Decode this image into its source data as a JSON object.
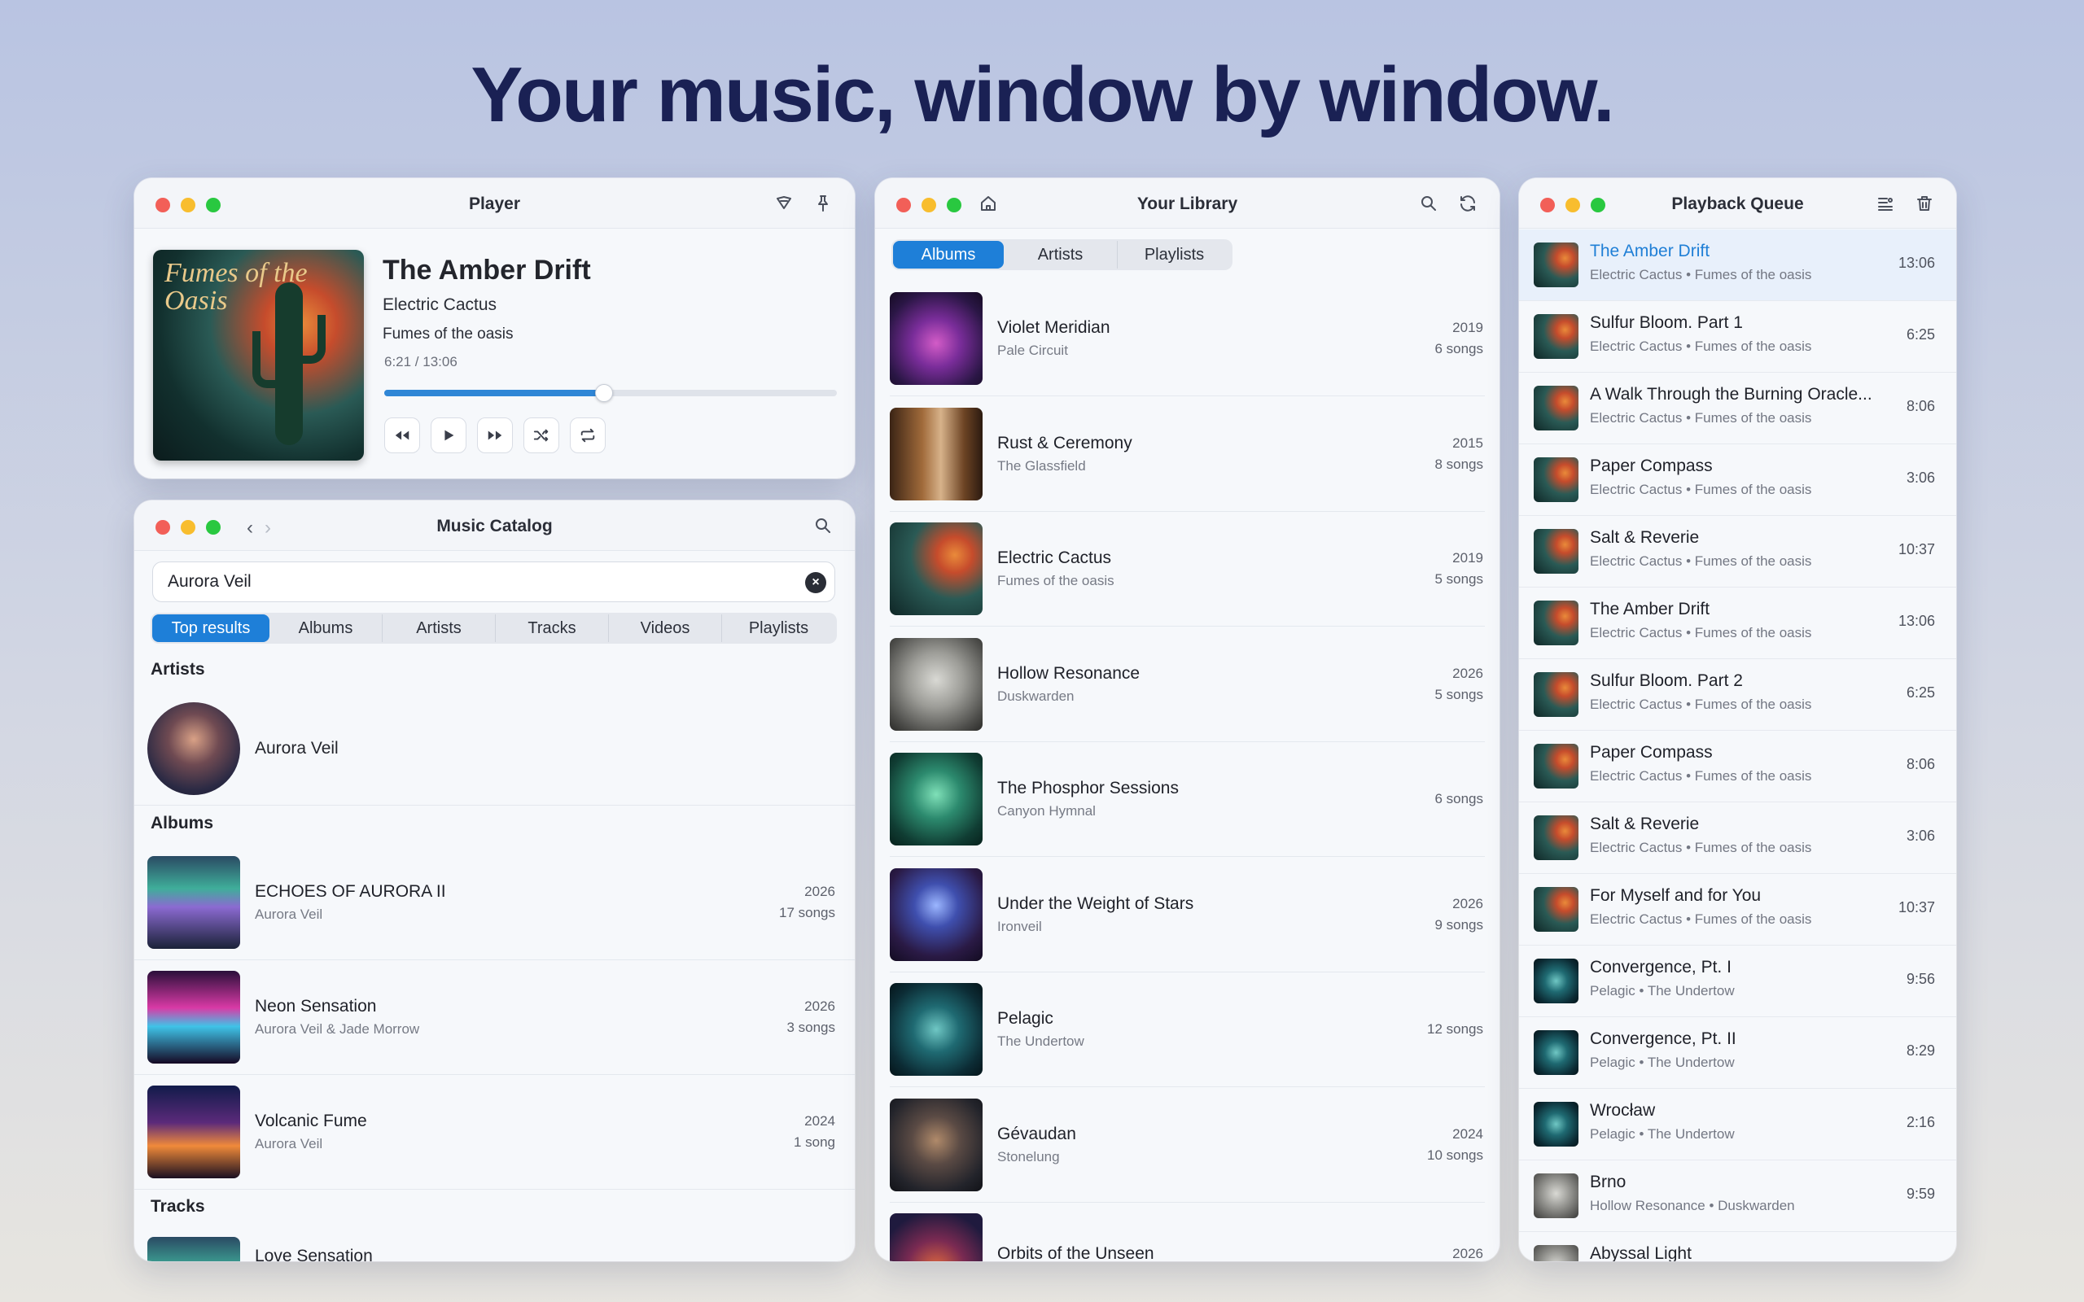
{
  "headline": "Your music, window by window.",
  "player": {
    "title": "Player",
    "cover_text": "Fumes of the Oasis",
    "track_title": "The Amber Drift",
    "artist": "Electric Cactus",
    "album": "Fumes of  the oasis",
    "time": "6:21 / 13:06",
    "progress": 0.485
  },
  "catalog": {
    "title": "Music Catalog",
    "search_value": "Aurora Veil",
    "tabs": [
      "Top results",
      "Albums",
      "Artists",
      "Tracks",
      "Videos",
      "Playlists"
    ],
    "active_tab": 0,
    "sections": {
      "artists": "Artists",
      "albums": "Albums",
      "tracks": "Tracks"
    },
    "artist": {
      "name": "Aurora Veil"
    },
    "albums": [
      {
        "title": "ECHOES OF AURORA II",
        "artist": "Aurora Veil",
        "year": "2026",
        "songs": "17 songs",
        "cover": "c-echo"
      },
      {
        "title": "Neon Sensation",
        "artist": "Aurora Veil & Jade Morrow",
        "year": "2026",
        "songs": "3 songs",
        "cover": "c-neon"
      },
      {
        "title": "Volcanic Fume",
        "artist": "Aurora Veil",
        "year": "2024",
        "songs": "1 song",
        "cover": "c-volc"
      }
    ],
    "track_partial": "Love Sensation"
  },
  "library": {
    "title": "Your Library",
    "tabs": [
      "Albums",
      "Artists",
      "Playlists"
    ],
    "active_tab": 0,
    "albums": [
      {
        "title": "Violet Meridian",
        "artist": "Pale Circuit",
        "year": "2019",
        "songs": "6 songs",
        "cover": "c-violet"
      },
      {
        "title": "Rust & Ceremony",
        "artist": "The Glassfield",
        "year": "2015",
        "songs": "8 songs",
        "cover": "c-rust"
      },
      {
        "title": "Electric Cactus",
        "artist": "Fumes of  the oasis",
        "year": "2019",
        "songs": "5 songs",
        "cover": "c-amber"
      },
      {
        "title": "Hollow Resonance",
        "artist": "Duskwarden",
        "year": "2026",
        "songs": "5 songs",
        "cover": "c-hollow"
      },
      {
        "title": "The Phosphor Sessions",
        "artist": "Canyon Hymnal",
        "year": "",
        "songs": "6 songs",
        "cover": "c-phos"
      },
      {
        "title": "Under the Weight of Stars",
        "artist": "Ironveil",
        "year": "2026",
        "songs": "9 songs",
        "cover": "c-under"
      },
      {
        "title": "Pelagic",
        "artist": "The Undertow",
        "year": "",
        "songs": "12 songs",
        "cover": "c-pel"
      },
      {
        "title": "Gévaudan",
        "artist": "Stonelung",
        "year": "2024",
        "songs": "10 songs",
        "cover": "c-gev"
      },
      {
        "title": "Orbits of the Unseen",
        "artist": "",
        "year": "2026",
        "songs": "",
        "cover": "c-orbit"
      }
    ]
  },
  "queue": {
    "title": "Playback Queue",
    "items": [
      {
        "title": "The Amber Drift",
        "sub": "Electric Cactus • Fumes of  the oasis",
        "dur": "13:06",
        "cover": "c-amber",
        "active": true
      },
      {
        "title": "Sulfur Bloom. Part 1",
        "sub": "Electric Cactus • Fumes of  the oasis",
        "dur": "6:25",
        "cover": "c-amber"
      },
      {
        "title": "A Walk Through the Burning Oracle...",
        "sub": "Electric Cactus • Fumes of  the oasis",
        "dur": "8:06",
        "cover": "c-amber"
      },
      {
        "title": "Paper Compass",
        "sub": "Electric Cactus • Fumes of  the oasis",
        "dur": "3:06",
        "cover": "c-amber"
      },
      {
        "title": "Salt & Reverie",
        "sub": "Electric Cactus • Fumes of  the oasis",
        "dur": "10:37",
        "cover": "c-amber"
      },
      {
        "title": "The Amber Drift",
        "sub": "Electric Cactus • Fumes of  the oasis",
        "dur": "13:06",
        "cover": "c-amber"
      },
      {
        "title": "Sulfur Bloom. Part 2",
        "sub": "Electric Cactus • Fumes of  the oasis",
        "dur": "6:25",
        "cover": "c-amber"
      },
      {
        "title": "Paper Compass",
        "sub": "Electric Cactus • Fumes of  the oasis",
        "dur": "8:06",
        "cover": "c-amber"
      },
      {
        "title": "Salt & Reverie",
        "sub": "Electric Cactus • Fumes of  the oasis",
        "dur": "3:06",
        "cover": "c-amber"
      },
      {
        "title": "For Myself and for You",
        "sub": "Electric Cactus • Fumes of  the oasis",
        "dur": "10:37",
        "cover": "c-amber"
      },
      {
        "title": "Convergence, Pt. I",
        "sub": "Pelagic • The Undertow",
        "dur": "9:56",
        "cover": "c-pel"
      },
      {
        "title": "Convergence, Pt. II",
        "sub": "Pelagic • The Undertow",
        "dur": "8:29",
        "cover": "c-pel"
      },
      {
        "title": "Wrocław",
        "sub": "Pelagic • The Undertow",
        "dur": "2:16",
        "cover": "c-pel"
      },
      {
        "title": "Brno",
        "sub": "Hollow Resonance • Duskwarden",
        "dur": "9:59",
        "cover": "c-brno"
      },
      {
        "title": "Abyssal Light",
        "sub": "",
        "dur": "",
        "cover": "c-brno"
      }
    ]
  }
}
